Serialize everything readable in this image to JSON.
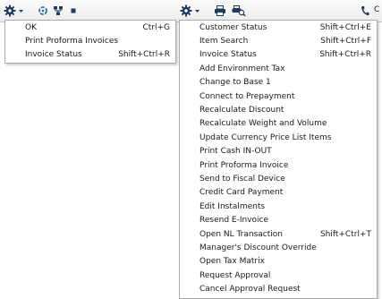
{
  "toolbar": {
    "left_buttons": [
      {
        "name": "gear-dropdown-button",
        "icon": "gear-icon"
      },
      {
        "name": "refresh-button",
        "icon": "refresh-icon"
      },
      {
        "name": "hierarchy-button",
        "icon": "hierarchy-icon"
      },
      {
        "name": "small-square-button",
        "icon": "square-icon"
      }
    ],
    "right_buttons": [
      {
        "name": "gear-dropdown-button-2",
        "icon": "gear-icon"
      },
      {
        "name": "print-button",
        "icon": "printer-icon"
      },
      {
        "name": "print-preview-button",
        "icon": "print-preview-icon"
      },
      {
        "name": "phone-button",
        "icon": "phone-icon"
      }
    ],
    "cut_text": "C"
  },
  "menu_left": {
    "items": [
      {
        "label": "OK",
        "shortcut": "Ctrl+G"
      },
      {
        "label": "Print Proforma Invoices",
        "shortcut": ""
      },
      {
        "label": "Invoice Status",
        "shortcut": "Shift+Ctrl+R"
      }
    ]
  },
  "menu_right": {
    "items": [
      {
        "label": "Customer Status",
        "shortcut": "Shift+Ctrl+E"
      },
      {
        "label": "Item Search",
        "shortcut": "Shift+Ctrl+F"
      },
      {
        "label": "Invoice Status",
        "shortcut": "Shift+Ctrl+R"
      },
      {
        "label": "Add Environment Tax",
        "shortcut": ""
      },
      {
        "label": "Change to Base 1",
        "shortcut": ""
      },
      {
        "label": "Connect to Prepayment",
        "shortcut": ""
      },
      {
        "label": "Recalculate Discount",
        "shortcut": ""
      },
      {
        "label": "Recalculate Weight and Volume",
        "shortcut": ""
      },
      {
        "label": "Update Currency Price List Items",
        "shortcut": ""
      },
      {
        "label": "Print Cash IN-OUT",
        "shortcut": ""
      },
      {
        "label": "Print Proforma Invoice",
        "shortcut": ""
      },
      {
        "label": "Send to Fiscal Device",
        "shortcut": ""
      },
      {
        "label": "Credit Card Payment",
        "shortcut": ""
      },
      {
        "label": "Edit Instalments",
        "shortcut": ""
      },
      {
        "label": "Resend E-Invoice",
        "shortcut": ""
      },
      {
        "label": "Open NL Transaction",
        "shortcut": "Shift+Ctrl+T"
      },
      {
        "label": "Manager's Discount Override",
        "shortcut": ""
      },
      {
        "label": "Open Tax Matrix",
        "shortcut": ""
      },
      {
        "label": "Request Approval",
        "shortcut": ""
      },
      {
        "label": "Cancel Approval Request",
        "shortcut": ""
      }
    ]
  }
}
